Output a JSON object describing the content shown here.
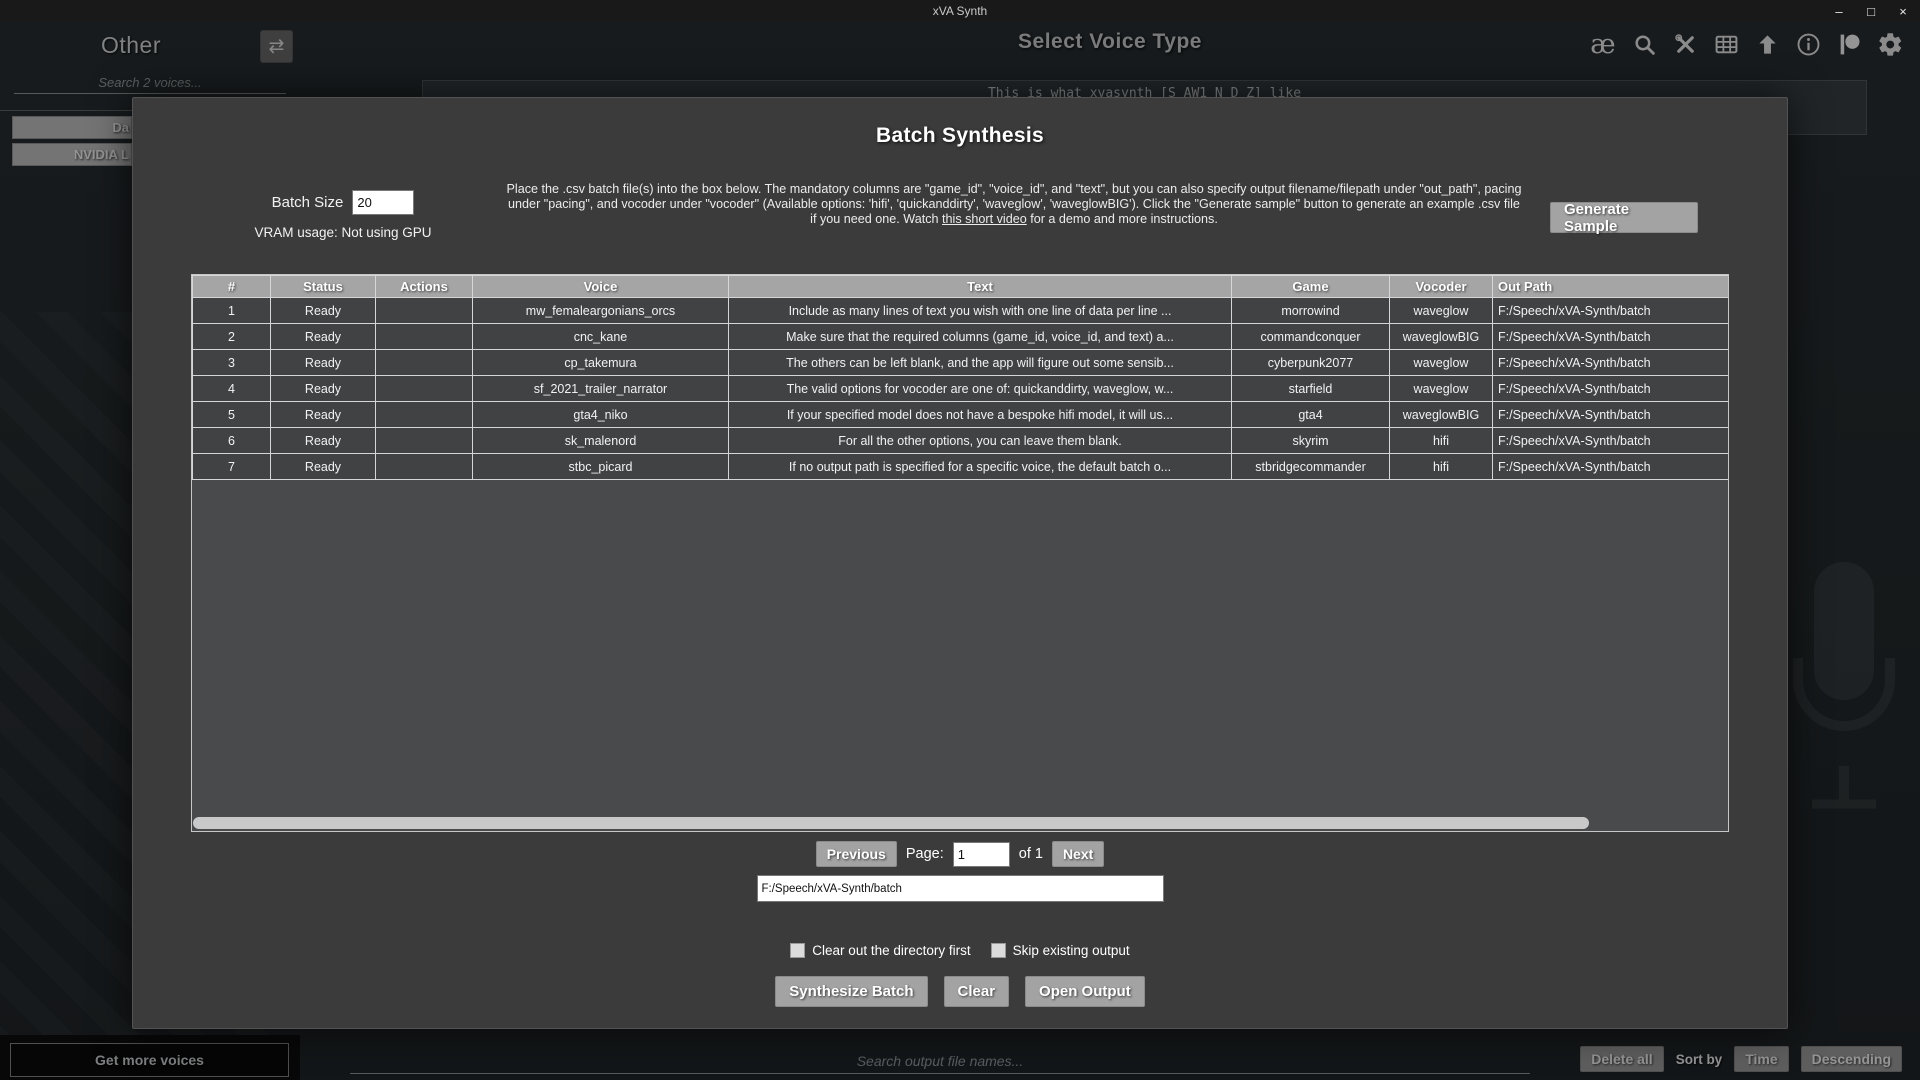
{
  "title_bar": {
    "title": "xVA Synth",
    "minimize": "–",
    "maximize": "□",
    "close": "×"
  },
  "toolbar": {
    "icons": [
      "phonemes-ae-icon",
      "search-icon",
      "plugins-icon",
      "batch-icon",
      "update-arrow-icon",
      "info-icon",
      "patreon-icon",
      "settings-gear-icon"
    ],
    "ae_glyph": "æ"
  },
  "sidebar": {
    "game_title": "Other",
    "swap_icon": "⇄",
    "search_placeholder": "Search 2 voices...",
    "voices": [
      "Da",
      "NVIDIA L"
    ],
    "get_more_voices": "Get more voices"
  },
  "main": {
    "header": "Select Voice Type",
    "preview_text": "This is what xvasynth [S AW1 N D Z] like"
  },
  "bottom_bar": {
    "search_placeholder": "Search output file names...",
    "delete_all": "Delete all",
    "sort_by": "Sort by",
    "time": "Time",
    "descending": "Descending"
  },
  "modal": {
    "title": "Batch Synthesis",
    "batch_size_label": "Batch Size",
    "batch_size_value": "20",
    "vram_label": "VRAM usage: Not using GPU",
    "instructions_pre": "Place the .csv batch file(s) into the box below. The mandatory columns are \"game_id\", \"voice_id\", and \"text\", but you can also specify output filename/filepath under \"out_path\", pacing under \"pacing\", and vocoder under \"vocoder\" (Available options: 'hifi', 'quickanddirty', 'waveglow', 'waveglowBIG'). Click the \"Generate sample\" button to generate an example .csv file if you need one. Watch ",
    "instructions_link": "this short video",
    "instructions_post": " for a demo and more instructions.",
    "generate_sample": "Generate Sample",
    "table": {
      "headers": [
        "#",
        "Status",
        "Actions",
        "Voice",
        "Text",
        "Game",
        "Vocoder",
        "Out Path"
      ],
      "rows": [
        [
          "1",
          "Ready",
          "",
          "mw_femaleargonians_orcs",
          "Include as many lines of text you wish with one line of data per line ...",
          "morrowind",
          "waveglow",
          "F:/Speech/xVA-Synth/batch"
        ],
        [
          "2",
          "Ready",
          "",
          "cnc_kane",
          "Make sure that the required columns (game_id, voice_id, and text) a...",
          "commandconquer",
          "waveglowBIG",
          "F:/Speech/xVA-Synth/batch"
        ],
        [
          "3",
          "Ready",
          "",
          "cp_takemura",
          "The others can be left blank, and the app will figure out some sensib...",
          "cyberpunk2077",
          "waveglow",
          "F:/Speech/xVA-Synth/batch"
        ],
        [
          "4",
          "Ready",
          "",
          "sf_2021_trailer_narrator",
          "The valid options for vocoder are one of: quickanddirty, waveglow, w...",
          "starfield",
          "waveglow",
          "F:/Speech/xVA-Synth/batch"
        ],
        [
          "5",
          "Ready",
          "",
          "gta4_niko",
          "If your specified model does not have a bespoke hifi model, it will us...",
          "gta4",
          "waveglowBIG",
          "F:/Speech/xVA-Synth/batch"
        ],
        [
          "6",
          "Ready",
          "",
          "sk_malenord",
          "For all the other options, you can leave them blank.",
          "skyrim",
          "hifi",
          "F:/Speech/xVA-Synth/batch"
        ],
        [
          "7",
          "Ready",
          "",
          "stbc_picard",
          "If no output path is specified for a specific voice, the default batch o...",
          "stbridgecommander",
          "hifi",
          "F:/Speech/xVA-Synth/batch"
        ]
      ]
    },
    "pagination": {
      "previous": "Previous",
      "page_label": "Page:",
      "page_value": "1",
      "of_label": "of 1",
      "next": "Next"
    },
    "output_path_value": "F:/Speech/xVA-Synth/batch",
    "checkbox_clear_label": "Clear out the directory first",
    "checkbox_skip_label": "Skip existing output",
    "synthesize_batch": "Synthesize Batch",
    "clear": "Clear",
    "open_output": "Open Output"
  }
}
